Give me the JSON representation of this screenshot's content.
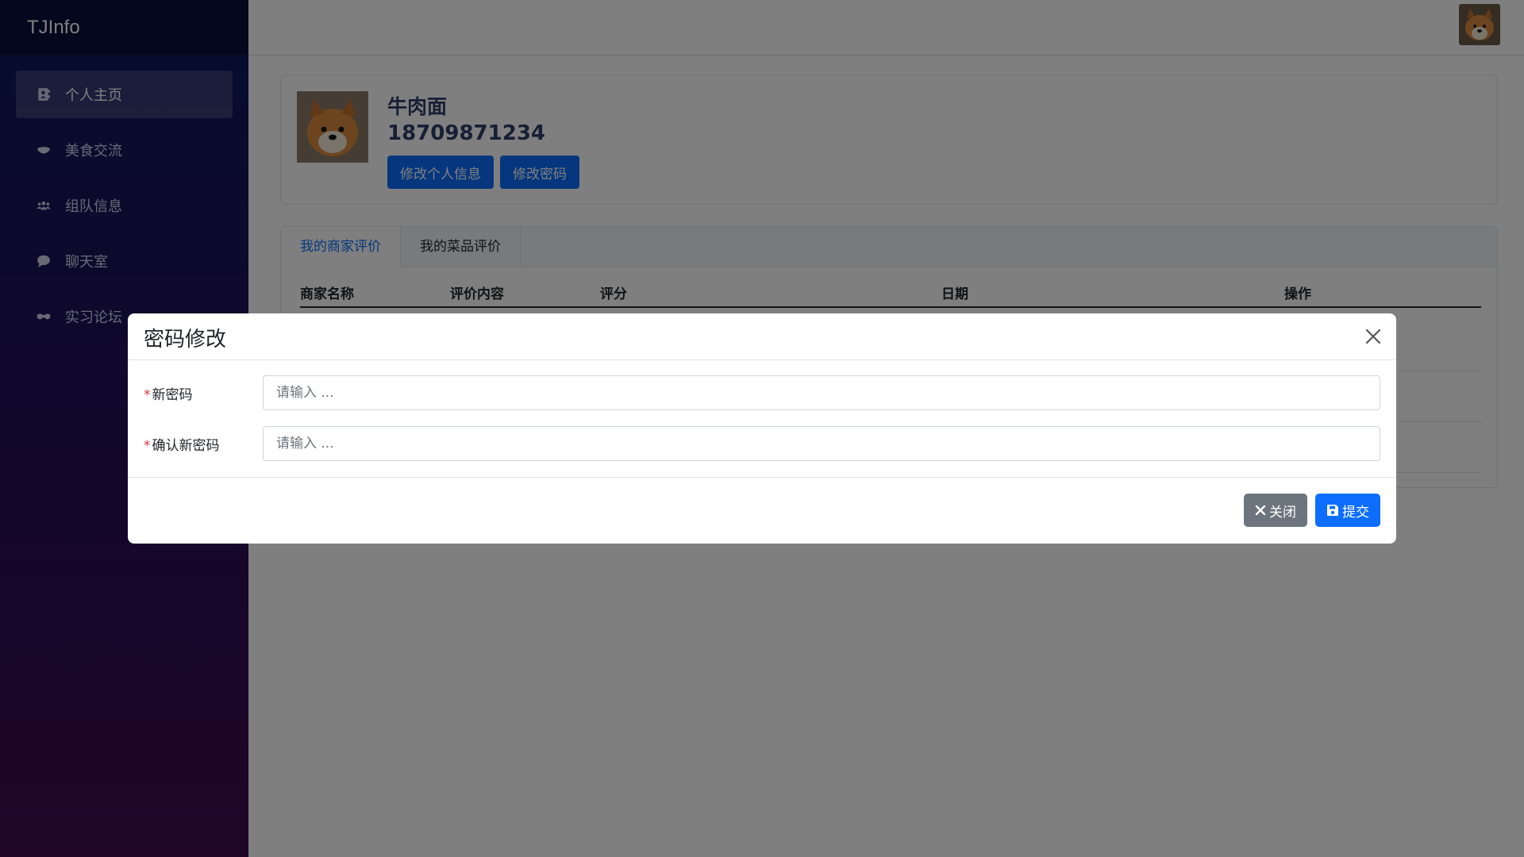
{
  "app": {
    "brand": "TJInfo"
  },
  "sidebar": {
    "items": [
      {
        "label": "个人主页",
        "icon": "address-card-icon",
        "active": true
      },
      {
        "label": "美食交流",
        "icon": "bowl-icon",
        "active": false
      },
      {
        "label": "组队信息",
        "icon": "users-icon",
        "active": false
      },
      {
        "label": "聊天室",
        "icon": "comment-icon",
        "active": false
      },
      {
        "label": "实习论坛",
        "icon": "handshake-icon",
        "active": false
      }
    ]
  },
  "profile": {
    "name": "牛肉面",
    "phone": "18709871234",
    "edit_info_label": "修改个人信息",
    "change_password_label": "修改密码",
    "avatar": "shiba-dog-avatar"
  },
  "reviews": {
    "tabs": [
      "我的商家评价",
      "我的菜品评价"
    ],
    "active_tab": 0,
    "columns": [
      "商家名称",
      "评价内容",
      "评分",
      "日期",
      "操作"
    ]
  },
  "modal": {
    "title": "密码修改",
    "fields": [
      {
        "label": "新密码",
        "placeholder": "请输入 ...",
        "required": true
      },
      {
        "label": "确认新密码",
        "placeholder": "请输入 ...",
        "required": true
      }
    ],
    "close_label": "关闭",
    "submit_label": "提交"
  },
  "colors": {
    "primary": "#0d6efd",
    "secondary": "#6c757d",
    "required": "#dc3545",
    "sidebar_top": "#0b1a5c",
    "sidebar_bottom": "#3e0c4e"
  }
}
